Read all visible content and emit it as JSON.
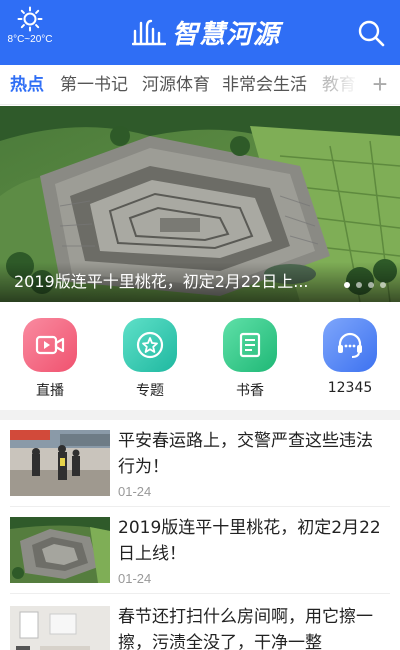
{
  "header": {
    "weather_temp": "8°C~20°C",
    "weather_icon": "sun-icon",
    "logo_text": "智慧河源",
    "search_icon": "search-icon"
  },
  "tabs": [
    {
      "label": "热点"
    },
    {
      "label": "第一书记"
    },
    {
      "label": "河源体育"
    },
    {
      "label": "非常会生活"
    },
    {
      "label": "教育"
    }
  ],
  "tabs_more_label": "+",
  "banner": {
    "title": "2019版连平十里桃花，初定2月22日上...",
    "dot_count": 4,
    "active_dot": 0
  },
  "shortcuts": [
    {
      "label": "直播",
      "icon": "video-icon",
      "color": "#f3627f"
    },
    {
      "label": "专题",
      "icon": "star-icon",
      "color": "#2ecab1"
    },
    {
      "label": "书香",
      "icon": "book-icon",
      "color": "#2fc98a"
    },
    {
      "label": "12345",
      "icon": "headset-icon",
      "color": "#4d86f6"
    }
  ],
  "news": [
    {
      "title": "平安春运路上，交警严查这些违法行为！",
      "date": "01-24",
      "thumb": "police-photo"
    },
    {
      "title": "2019版连平十里桃花，初定2月22日上线！",
      "date": "01-24",
      "thumb": "village-photo"
    },
    {
      "title": "春节还打扫什么房间啊，用它擦一擦，污渍全没了，干净一整",
      "date": "",
      "thumb": "room-photo"
    }
  ],
  "colors": {
    "brand_blue": "#2f6ef5",
    "tab_active": "#2f6ef5"
  }
}
